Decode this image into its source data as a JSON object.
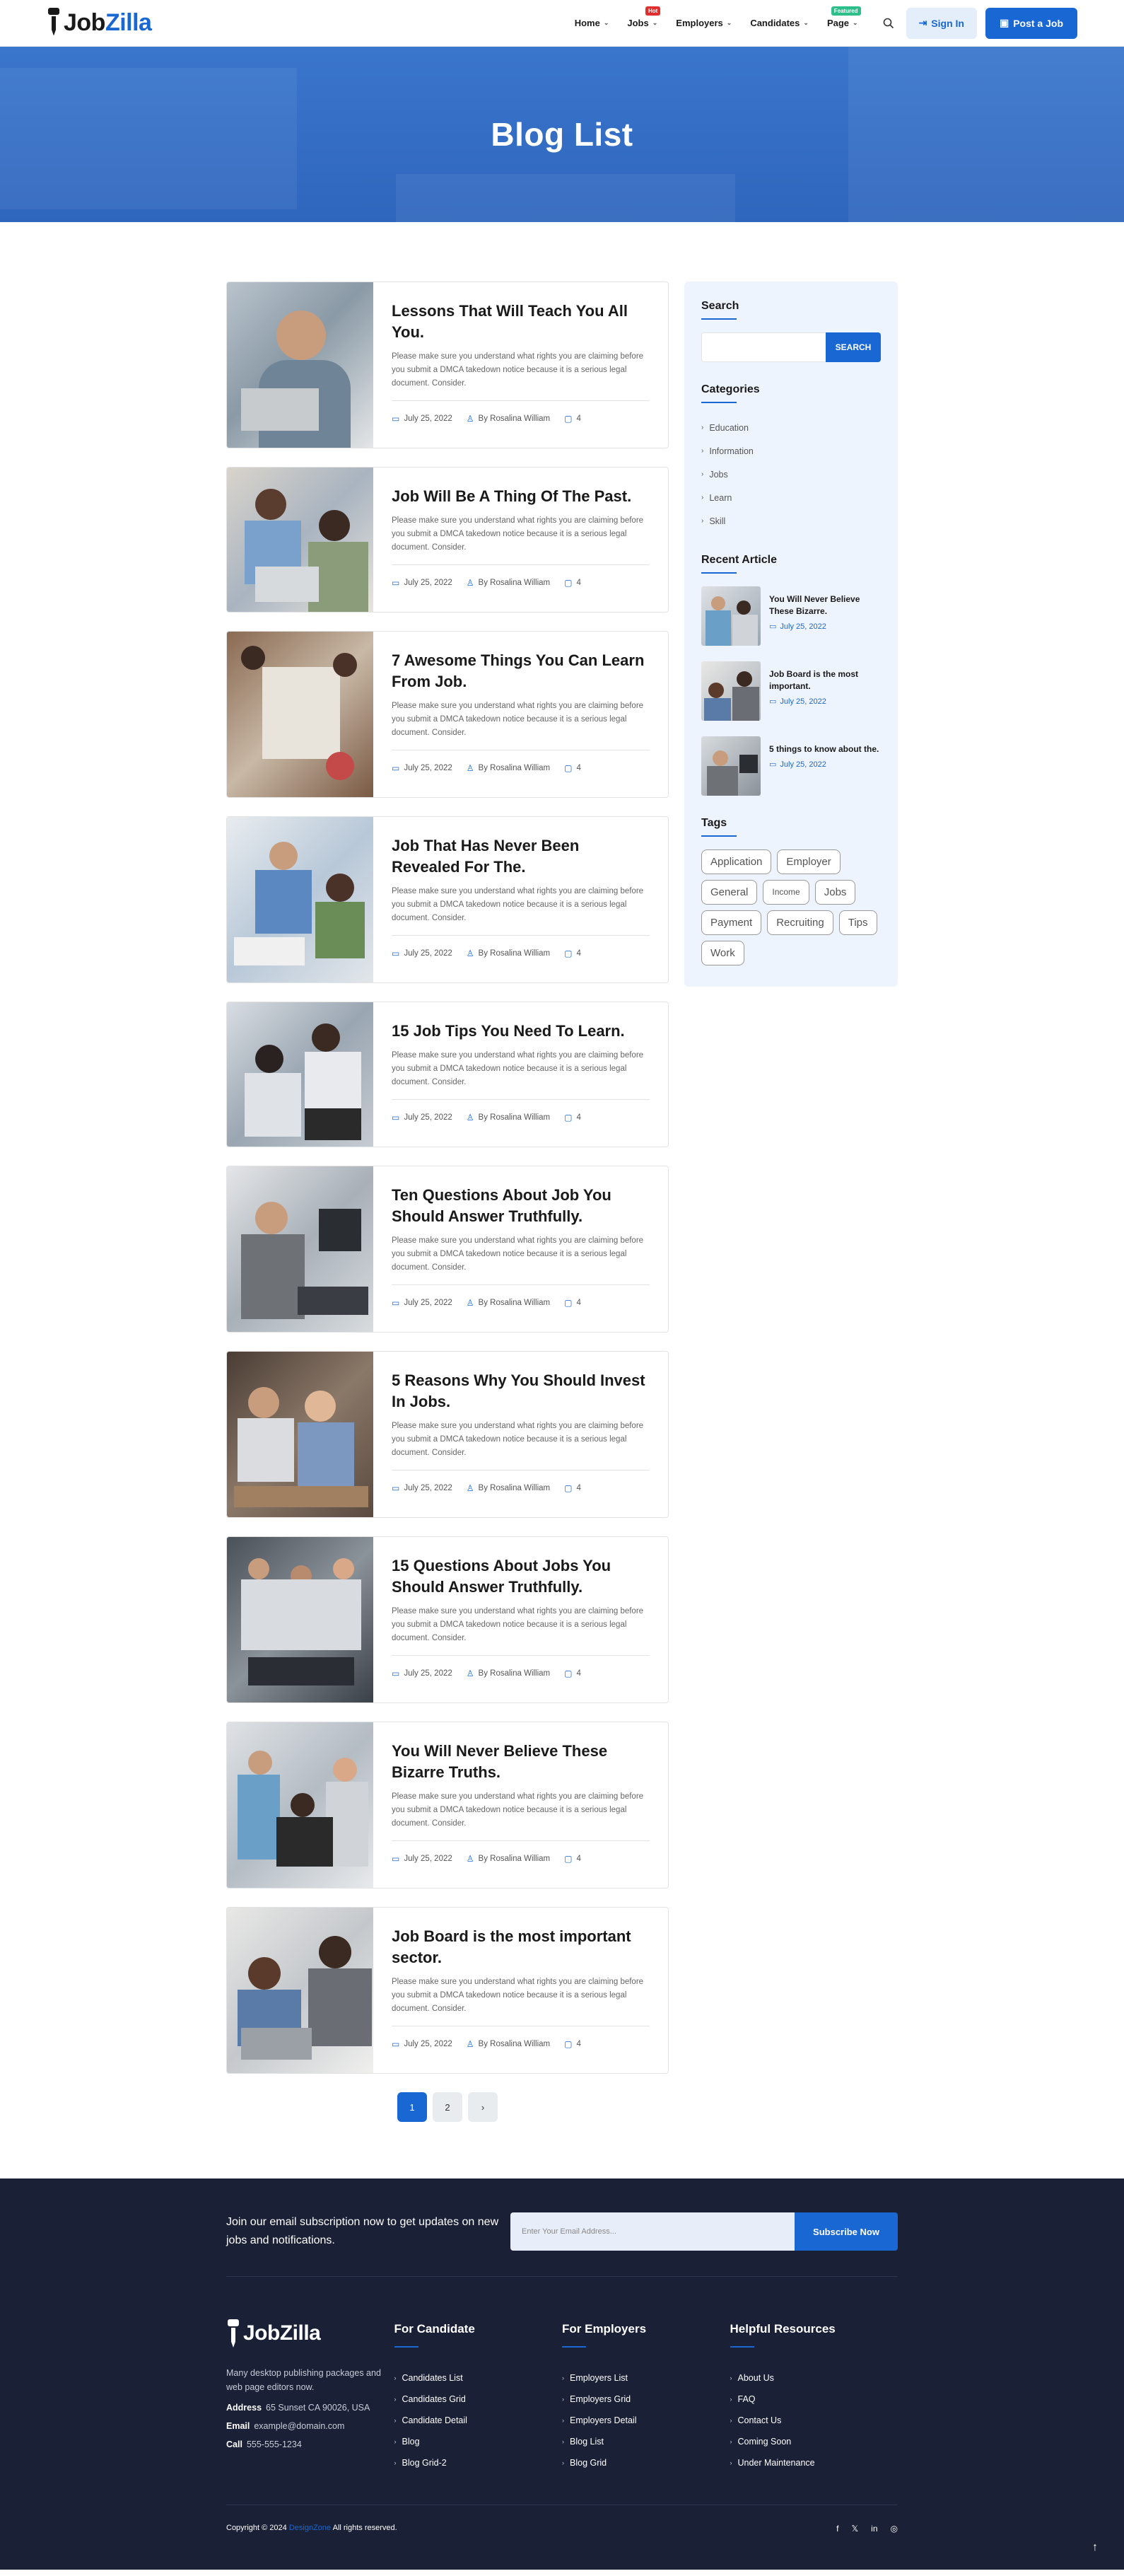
{
  "header": {
    "logo": {
      "part1": "Job",
      "part2": "Zilla"
    },
    "nav": [
      {
        "label": "Home",
        "badge": ""
      },
      {
        "label": "Jobs",
        "badge": "Hot"
      },
      {
        "label": "Employers",
        "badge": ""
      },
      {
        "label": "Candidates",
        "badge": ""
      },
      {
        "label": "Page",
        "badge": "Featured"
      }
    ],
    "signin_label": "Sign In",
    "post_job_label": "Post a Job"
  },
  "banner": {
    "title": "Blog List"
  },
  "posts": [
    {
      "title": "Lessons That Will Teach You All You.",
      "excerpt": "Please make sure you understand what rights you are claiming before you submit a DMCA takedown notice because it is a serious legal document. Consider.",
      "date": "July 25, 2022",
      "author": "By  Rosalina William",
      "comments": "4"
    },
    {
      "title": "Job Will Be A Thing Of The Past.",
      "excerpt": "Please make sure you understand what rights you are claiming before you submit a DMCA takedown notice because it is a serious legal document. Consider.",
      "date": "July 25, 2022",
      "author": "By  Rosalina William",
      "comments": "4"
    },
    {
      "title": "7 Awesome Things You Can Learn From Job.",
      "excerpt": "Please make sure you understand what rights you are claiming before you submit a DMCA takedown notice because it is a serious legal document. Consider.",
      "date": "July 25, 2022",
      "author": "By  Rosalina William",
      "comments": "4"
    },
    {
      "title": "Job That Has Never Been Revealed For The.",
      "excerpt": "Please make sure you understand what rights you are claiming before you submit a DMCA takedown notice because it is a serious legal document. Consider.",
      "date": "July 25, 2022",
      "author": "By  Rosalina William",
      "comments": "4"
    },
    {
      "title": "15 Job Tips You Need To Learn.",
      "excerpt": "Please make sure you understand what rights you are claiming before you submit a DMCA takedown notice because it is a serious legal document. Consider.",
      "date": "July 25, 2022",
      "author": "By  Rosalina William",
      "comments": "4"
    },
    {
      "title": "Ten Questions About Job You Should Answer Truthfully.",
      "excerpt": "Please make sure you understand what rights you are claiming before you submit a DMCA takedown notice because it is a serious legal document. Consider.",
      "date": "July 25, 2022",
      "author": "By  Rosalina William",
      "comments": "4"
    },
    {
      "title": "5 Reasons Why You Should Invest In Jobs.",
      "excerpt": "Please make sure you understand what rights you are claiming before you submit a DMCA takedown notice because it is a serious legal document. Consider.",
      "date": "July 25, 2022",
      "author": "By  Rosalina William",
      "comments": "4"
    },
    {
      "title": "15 Questions About Jobs You Should Answer Truthfully.",
      "excerpt": "Please make sure you understand what rights you are claiming before you submit a DMCA takedown notice because it is a serious legal document. Consider.",
      "date": "July 25, 2022",
      "author": "By  Rosalina William",
      "comments": "4"
    },
    {
      "title": "You Will Never Believe These Bizarre Truths.",
      "excerpt": "Please make sure you understand what rights you are claiming before you submit a DMCA takedown notice because it is a serious legal document. Consider.",
      "date": "July 25, 2022",
      "author": "By  Rosalina William",
      "comments": "4"
    },
    {
      "title": "Job Board is the most important sector.",
      "excerpt": "Please make sure you understand what rights you are claiming before you submit a DMCA takedown notice because it is a serious legal document. Consider.",
      "date": "July 25, 2022",
      "author": "By  Rosalina William",
      "comments": "4"
    }
  ],
  "pagination": {
    "pages": [
      "1",
      "2"
    ],
    "next": "›"
  },
  "sidebar": {
    "search_title": "Search",
    "search_button": "SEARCH",
    "search_value": "",
    "categories_title": "Categories",
    "categories": [
      "Education",
      "Information",
      "Jobs",
      "Learn",
      "Skill"
    ],
    "recent_title": "Recent Article",
    "recent": [
      {
        "title": "You Will Never Believe These Bizarre.",
        "date": "July 25, 2022"
      },
      {
        "title": "Job Board is the most important.",
        "date": "July 25, 2022"
      },
      {
        "title": "5 things to know about the.",
        "date": "July 25, 2022"
      }
    ],
    "tags_title": "Tags",
    "tags": [
      "Application",
      "Employer",
      "General",
      "Income",
      "Jobs",
      "Payment",
      "Recruiting",
      "Tips",
      "Work"
    ]
  },
  "footer": {
    "subscribe_text": "Join our email subscription now to get updates on new jobs and notifications.",
    "subscribe_placeholder": "Enter Your Email Address...",
    "subscribe_button": "Subscribe Now",
    "logo": {
      "part1": "Job",
      "part2": "Zilla"
    },
    "description": "Many desktop publishing packages and web page editors now.",
    "address_label": "Address",
    "address": "65 Sunset CA 90026, USA",
    "email_label": "Email",
    "email": "example@domain.com",
    "call_label": "Call",
    "phone": "555-555-1234",
    "col_candidate": {
      "title": "For Candidate",
      "links": [
        "Candidates List",
        "Candidates Grid",
        "Candidate Detail",
        "Blog",
        "Blog Grid-2"
      ]
    },
    "col_employers": {
      "title": "For Employers",
      "links": [
        "Employers List",
        "Employers Grid",
        "Employers Detail",
        "Blog List",
        "Blog Grid"
      ]
    },
    "col_resources": {
      "title": "Helpful Resources",
      "links": [
        "About Us",
        "FAQ",
        "Contact Us",
        "Coming Soon",
        "Under Maintenance"
      ]
    },
    "copyright_prefix": "Copyright © 2024",
    "copyright_brand": "DesignZone",
    "copyright_suffix": "All rights reserved."
  },
  "colors": {
    "primary": "#1967d2",
    "footer_bg": "#1a2035",
    "sidebar_bg": "#eef4fd",
    "badge_hot": "#e02d2d",
    "badge_featured": "#2dbf8a"
  }
}
